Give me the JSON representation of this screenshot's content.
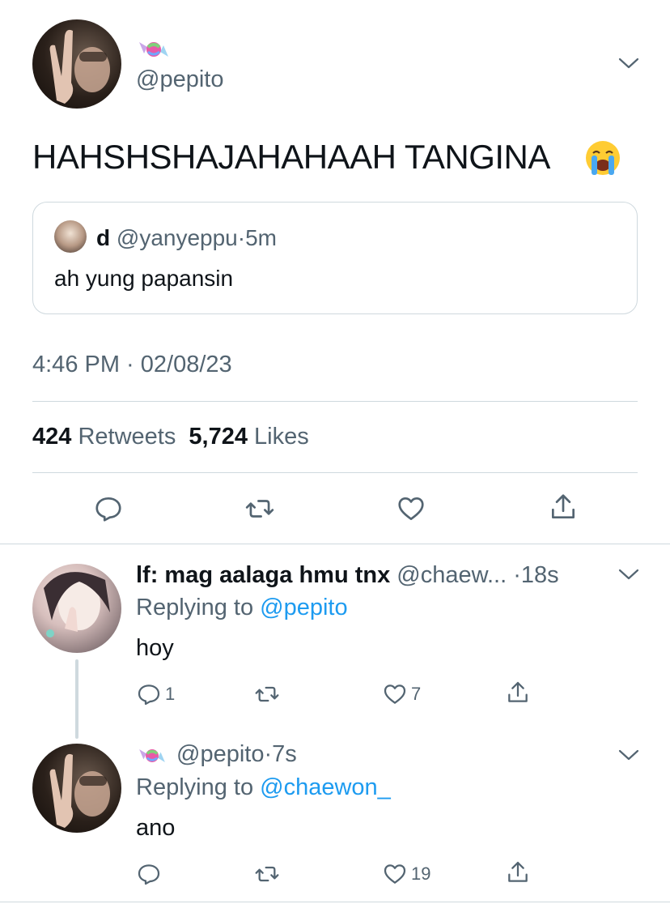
{
  "main_tweet": {
    "handle": "@pepito",
    "avatar_icon": "peace-sign-avatar",
    "name_icon": "candy-icon",
    "text": "HAHSHSHAJAHAHAAH TANGINA",
    "emoji": "loudly-crying-face",
    "quote": {
      "name": "d",
      "handle": "@yanyeppu",
      "separator": "·",
      "time": "5m",
      "text": "ah yung papansin"
    },
    "timestamp": "4:46 PM · 02/08/23",
    "retweets_count": "424",
    "retweets_label": "Retweets",
    "likes_count": "5,724",
    "likes_label": "Likes"
  },
  "replies": [
    {
      "name": "lf: mag aalaga hmu tnx",
      "handle": "@chaew...",
      "time": "·18s",
      "replying_to_label": "Replying to",
      "replying_to_handle": "@pepito",
      "text": "hoy",
      "reply_count": "1",
      "retweet_count": "",
      "like_count": "7"
    },
    {
      "handle": "@pepito",
      "time": "·7s",
      "name_icon": "candy-icon",
      "replying_to_label": "Replying to",
      "replying_to_handle": "@chaewon_",
      "text": "ano",
      "reply_count": "",
      "retweet_count": "",
      "like_count": "19"
    }
  ],
  "colors": {
    "text": "#0f1419",
    "secondary": "#536471",
    "link": "#1d9bf0",
    "border": "#cfd9de"
  }
}
